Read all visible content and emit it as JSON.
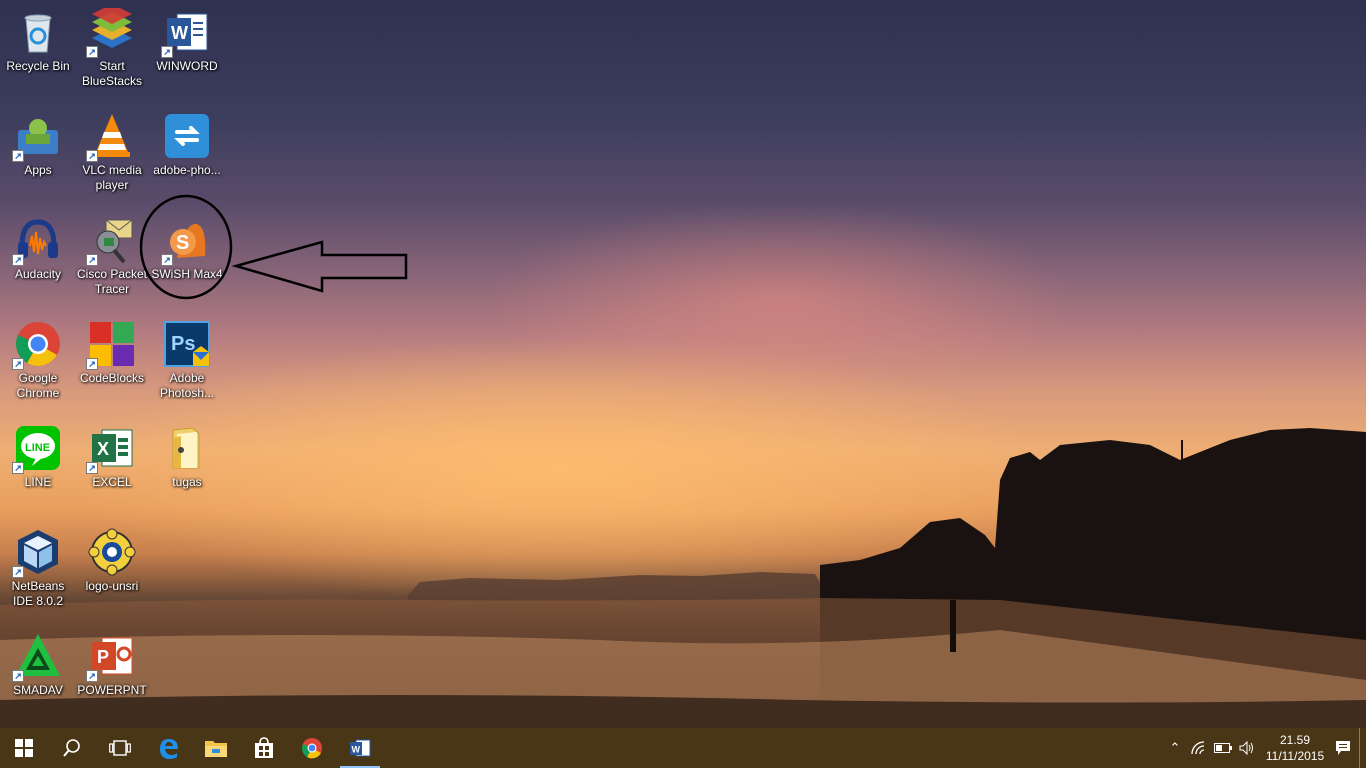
{
  "desktop": {
    "icons": [
      {
        "label": "Recycle Bin",
        "icon": "recycle-bin-icon"
      },
      {
        "label": "Start BlueStacks",
        "icon": "bluestacks-icon"
      },
      {
        "label": "WINWORD",
        "icon": "word-icon"
      },
      {
        "label": "Apps",
        "icon": "apps-icon"
      },
      {
        "label": "VLC media player",
        "icon": "vlc-icon"
      },
      {
        "label": "adobe-pho...",
        "icon": "adobe-photoshop-express-icon"
      },
      {
        "label": "Audacity",
        "icon": "audacity-icon"
      },
      {
        "label": "Cisco Packet Tracer",
        "icon": "cisco-packet-tracer-icon"
      },
      {
        "label": "SWiSH Max4",
        "icon": "swish-max-icon"
      },
      {
        "label": "Google Chrome",
        "icon": "chrome-icon"
      },
      {
        "label": "CodeBlocks",
        "icon": "codeblocks-icon"
      },
      {
        "label": "Adobe Photosh...",
        "icon": "photoshop-icon"
      },
      {
        "label": "LINE",
        "icon": "line-icon"
      },
      {
        "label": "EXCEL",
        "icon": "excel-icon"
      },
      {
        "label": "tugas",
        "icon": "folder-icon"
      },
      {
        "label": "NetBeans IDE 8.0.2",
        "icon": "netbeans-icon"
      },
      {
        "label": "logo-unsri",
        "icon": "unsri-logo-icon"
      },
      {
        "label": "SMADAV",
        "icon": "smadav-icon"
      },
      {
        "label": "POWERPNT",
        "icon": "powerpoint-icon"
      }
    ],
    "annotation": {
      "highlighted": "SWiSH Max4",
      "marks": [
        "circle",
        "arrow"
      ]
    }
  },
  "taskbar": {
    "buttons": [
      "start-icon",
      "search-icon",
      "task-view-icon",
      "edge-icon",
      "file-explorer-icon",
      "store-icon",
      "chrome-icon",
      "word-icon"
    ],
    "active": "word-icon",
    "tray": {
      "icons": [
        "chevron-up-icon",
        "wifi-icon",
        "battery-icon",
        "volume-icon",
        "action-center-icon"
      ],
      "time": "21.59",
      "date": "11/11/2015"
    }
  }
}
